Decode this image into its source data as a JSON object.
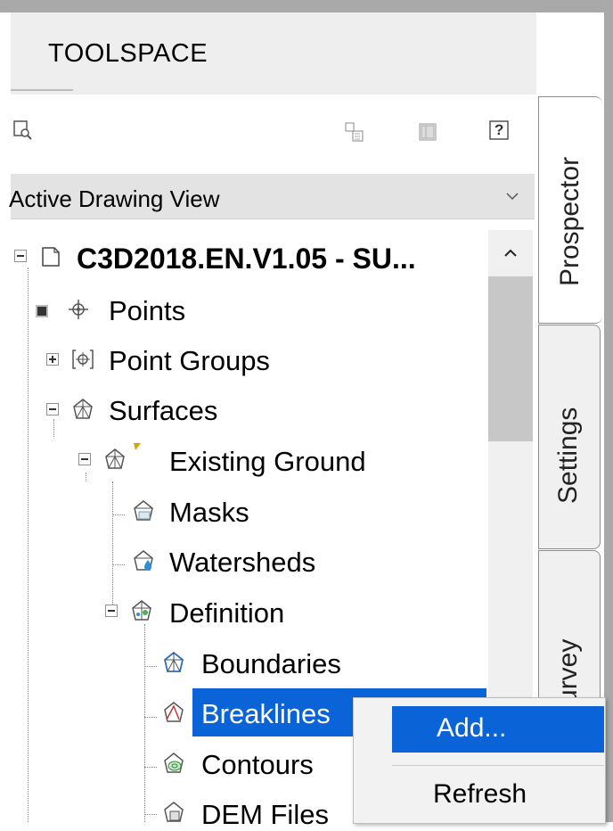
{
  "window": {
    "title": "TOOLSPACE"
  },
  "toolbar": {
    "icons": [
      "preview-icon",
      "copy-icon",
      "panel-icon",
      "help-icon"
    ],
    "help_label": "?"
  },
  "view": {
    "selected": "Active Drawing View"
  },
  "tree": {
    "root": "C3D2018.EN.V1.05 - SU...",
    "points": "Points",
    "point_groups": "Point Groups",
    "surfaces": "Surfaces",
    "existing_ground": "Existing Ground",
    "masks": "Masks",
    "watersheds": "Watersheds",
    "definition": "Definition",
    "boundaries": "Boundaries",
    "breaklines": "Breaklines",
    "contours": "Contours",
    "dem_files": "DEM Files"
  },
  "tabs": {
    "prospector": "Prospector",
    "settings": "Settings",
    "survey": "Survey"
  },
  "context_menu": {
    "add": "Add...",
    "refresh": "Refresh"
  },
  "colors": {
    "selection": "#0a64d7",
    "frame": "#a9a9a9",
    "titlebar": "#eeeeee"
  }
}
